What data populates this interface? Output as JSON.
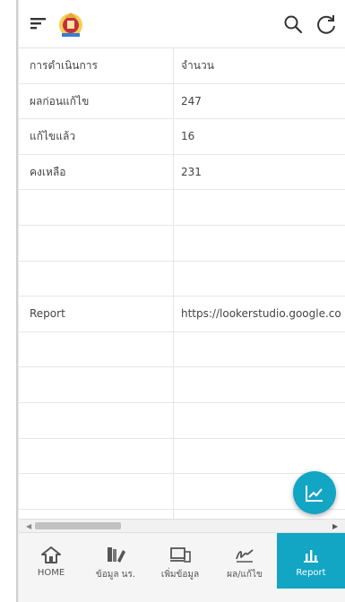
{
  "colors": {
    "accent": "#12a5c4",
    "nav_bg": "#f5f5f5",
    "text": "#444444"
  },
  "appbar": {
    "menu_icon": "menu-icon",
    "logo": "emblem-logo",
    "search_icon": "search-icon",
    "refresh_icon": "refresh-icon"
  },
  "table": {
    "headers": [
      "การดำเนินการ",
      "จำนวน"
    ],
    "rows": [
      [
        "ผลก่อนแก้ไข",
        "247"
      ],
      [
        "แก้ไขแล้ว",
        "16"
      ],
      [
        "คงเหลือ",
        "231"
      ],
      [
        "",
        ""
      ],
      [
        "",
        ""
      ],
      [
        "",
        ""
      ],
      [
        "Report",
        "https://lookerstudio.google.co"
      ],
      [
        "",
        ""
      ],
      [
        "",
        ""
      ],
      [
        "",
        ""
      ],
      [
        "",
        ""
      ],
      [
        "",
        ""
      ]
    ]
  },
  "fab": {
    "icon": "chart-line-icon"
  },
  "nav": {
    "items": [
      {
        "label": "HOME",
        "icon": "home-icon"
      },
      {
        "label": "ข้อมูล นร.",
        "icon": "student-data-icon"
      },
      {
        "label": "เพิ่มข้อมูล",
        "icon": "devices-icon"
      },
      {
        "label": "ผล/แก้ไข",
        "icon": "signature-icon"
      },
      {
        "label": "Report",
        "icon": "bar-chart-icon"
      }
    ],
    "active_index": 4
  }
}
